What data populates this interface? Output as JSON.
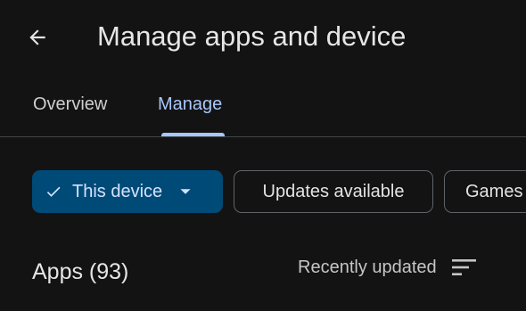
{
  "header": {
    "title": "Manage apps and device",
    "back_icon": "arrow-back-icon"
  },
  "tabs": [
    {
      "label": "Overview",
      "selected": false
    },
    {
      "label": "Manage",
      "selected": true
    }
  ],
  "filters": {
    "device_chip": {
      "label": "This device",
      "selected": true,
      "icon": "check-icon",
      "dropdown_icon": "caret-down-icon"
    },
    "updates_chip": {
      "label": "Updates available"
    },
    "games_chip": {
      "label": "Games"
    }
  },
  "apps_section": {
    "count_label": "Apps (93)",
    "sort_label": "Recently updated",
    "sort_icon": "sort-icon"
  },
  "colors": {
    "background": "#131313",
    "accent": "#a8c7fa",
    "selected_chip_bg": "#004a77",
    "selected_chip_text": "#d3e3fd",
    "divider": "#444746"
  }
}
